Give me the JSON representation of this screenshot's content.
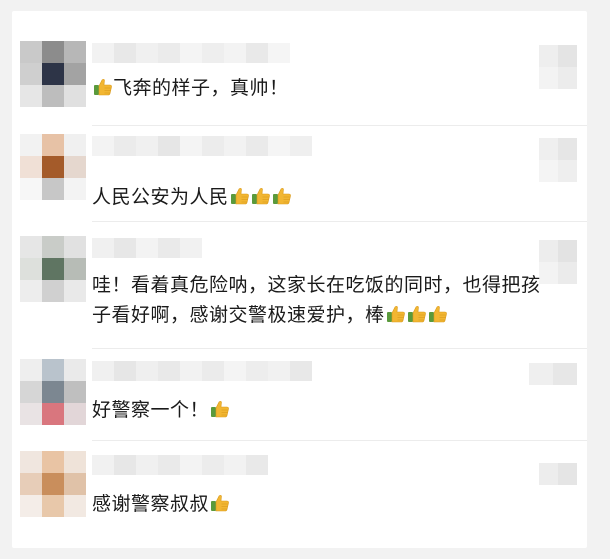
{
  "comments": [
    {
      "text": "飞奔的样子，真帅！",
      "emoji_position": "before",
      "emoji_count": 1,
      "emoji_name": "thumbs-up-icon"
    },
    {
      "text": "人民公安为人民",
      "emoji_position": "after",
      "emoji_count": 3,
      "emoji_name": "thumbs-up-icon"
    },
    {
      "text_line1": "哇！看着真危险呐，这家长在吃饭的同时，也得把孩",
      "text_line2": "子看好啊，感谢交警极速爱护，棒",
      "emoji_position": "after",
      "emoji_count": 3,
      "emoji_name": "thumbs-up-icon"
    },
    {
      "text": "好警察一个！",
      "emoji_position": "after",
      "emoji_count": 1,
      "emoji_name": "thumbs-up-icon"
    },
    {
      "text": "感谢警察叔叔",
      "emoji_position": "after",
      "emoji_count": 1,
      "emoji_name": "thumbs-up-icon"
    }
  ],
  "colors": {
    "background": "#f2f2f2",
    "card": "#ffffff",
    "text": "#1a1a1a",
    "thumb_yellow": "#f2b632",
    "thumb_sleeve": "#5a9a3c"
  }
}
